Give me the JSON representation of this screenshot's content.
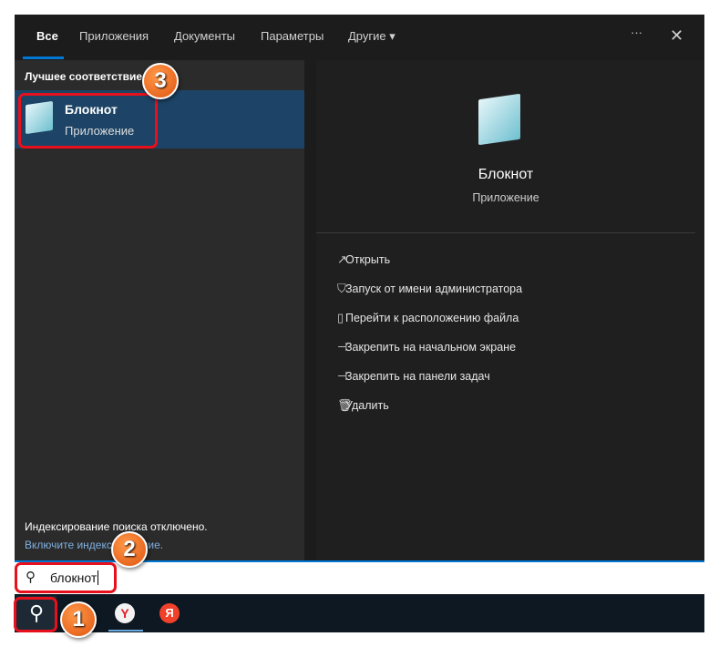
{
  "tabs": [
    {
      "label": "Все"
    },
    {
      "label": "Приложения"
    },
    {
      "label": "Документы"
    },
    {
      "label": "Параметры"
    },
    {
      "label": "Другие"
    }
  ],
  "header": {
    "more": "···",
    "close": "✕"
  },
  "best_match": {
    "heading": "Лучшее соответствие",
    "name": "Блокнот",
    "type": "Приложение"
  },
  "preview": {
    "name": "Блокнот",
    "type": "Приложение"
  },
  "actions": [
    {
      "label": "Открыть",
      "icon": "open-icon"
    },
    {
      "label": "Запуск от имени администратора",
      "icon": "shield-icon"
    },
    {
      "label": "Перейти к расположению файла",
      "icon": "folder-icon"
    },
    {
      "label": "Закрепить на начальном экране",
      "icon": "pin-icon"
    },
    {
      "label": "Закрепить на панели задач",
      "icon": "pin-icon"
    },
    {
      "label": "Удалить",
      "icon": "trash-icon"
    }
  ],
  "indexing": {
    "note": "Индексирование поиска отключено.",
    "link": "Включите индексирование."
  },
  "search": {
    "value": "блокнот"
  },
  "badges": [
    "1",
    "2",
    "3"
  ],
  "colors": {
    "accent": "#0078d4",
    "highlight": "#e8101c"
  }
}
